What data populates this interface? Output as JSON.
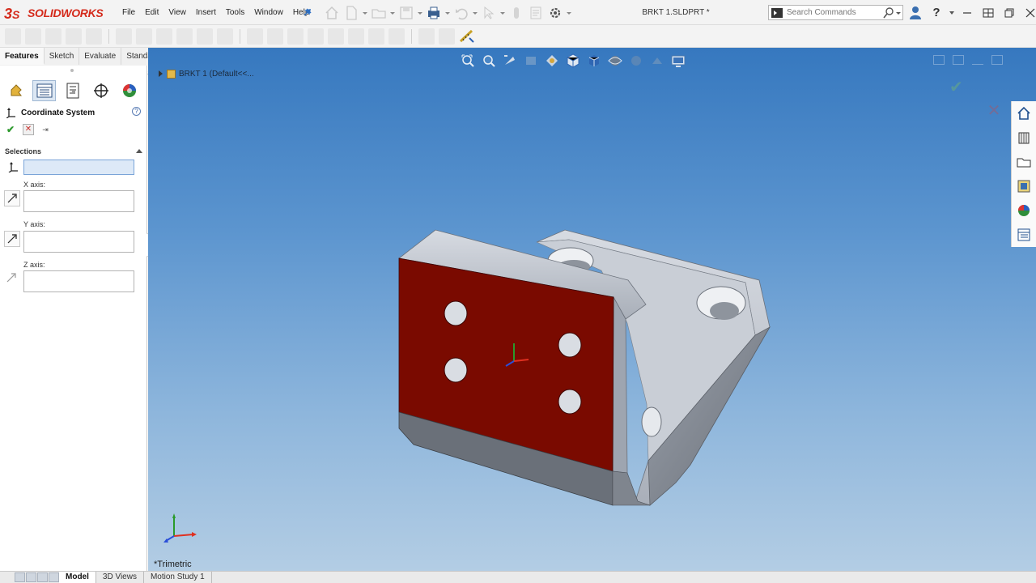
{
  "app": {
    "logo_prefix": "3DS",
    "logo_text": "SOLIDWORKS",
    "document_title": "BRKT 1.SLDPRT *"
  },
  "menu": [
    "File",
    "Edit",
    "View",
    "Insert",
    "Tools",
    "Window",
    "Help"
  ],
  "search": {
    "placeholder": "Search Commands"
  },
  "command_tabs": [
    {
      "label": "Features",
      "active": true
    },
    {
      "label": "Sketch",
      "active": false
    },
    {
      "label": "Evaluate",
      "active": false
    },
    {
      "label": "Standard Views",
      "active": false
    }
  ],
  "property_manager": {
    "title": "Coordinate System",
    "help_glyph": "?",
    "ok_glyph": "✔",
    "cancel_glyph": "✕",
    "pin_glyph": "⇥",
    "selections_group": "Selections",
    "x_axis_label": "X axis:",
    "y_axis_label": "Y axis:",
    "z_axis_label": "Z axis:"
  },
  "viewport": {
    "tree_crumb": "BRKT 1  (Default<<...",
    "view_orientation": "*Trimetric",
    "face_color": "#7a0a00",
    "background_top": "#3678bf",
    "background_bottom": "#b3cde4"
  },
  "bottom_tabs": [
    {
      "label": "Model",
      "active": true
    },
    {
      "label": "3D Views",
      "active": false
    },
    {
      "label": "Motion Study 1",
      "active": false
    }
  ],
  "icons": {
    "manager_tabs": [
      "feature-manager-icon",
      "property-manager-icon",
      "configuration-manager-icon",
      "dimxpert-manager-icon",
      "display-manager-icon"
    ],
    "task_pane": [
      "home-icon",
      "design-library-icon",
      "file-explorer-icon",
      "view-palette-icon",
      "appearances-icon",
      "custom-properties-icon"
    ]
  }
}
